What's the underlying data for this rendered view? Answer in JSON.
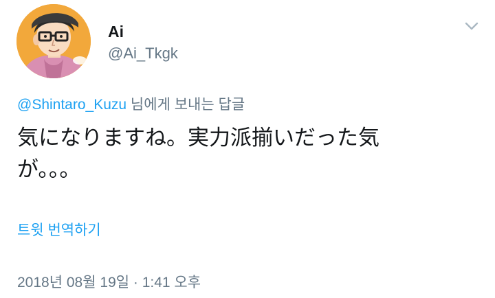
{
  "author": {
    "display_name": "Ai",
    "username": "@Ai_Tkgk"
  },
  "reply": {
    "mention": "@Shintaro_Kuzu",
    "suffix": " 님에게 보내는 답글"
  },
  "tweet": {
    "text": "気になりますね。実力派揃いだった気が。。。"
  },
  "translate_label": "트윗 번역하기",
  "timestamp": "2018년 08월 19일 · 1:41 오후",
  "icons": {
    "menu": "chevron-down-icon",
    "avatar": "avatar"
  },
  "colors": {
    "link": "#1da1f2",
    "secondary_text": "#657786",
    "primary_text": "#14171a",
    "avatar_background": "#f2a83b"
  }
}
